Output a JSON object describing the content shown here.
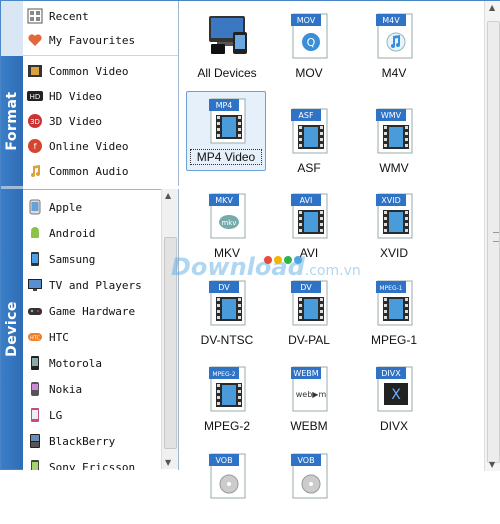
{
  "tabs": {
    "format": "Format",
    "device": "Device"
  },
  "format_list": [
    {
      "label": "Recent",
      "icon": "recent-icon"
    },
    {
      "label": "My Favourites",
      "icon": "heart-icon"
    },
    {
      "label": "Common Video",
      "icon": "film-icon"
    },
    {
      "label": "HD Video",
      "icon": "hd-icon"
    },
    {
      "label": "3D Video",
      "icon": "3d-icon"
    },
    {
      "label": "Online Video",
      "icon": "online-video-icon"
    },
    {
      "label": "Common Audio",
      "icon": "music-note-icon"
    }
  ],
  "device_list": [
    {
      "label": "Apple",
      "icon": "apple-icon"
    },
    {
      "label": "Android",
      "icon": "android-icon"
    },
    {
      "label": "Samsung",
      "icon": "samsung-phone-icon"
    },
    {
      "label": "TV and Players",
      "icon": "tv-icon"
    },
    {
      "label": "Game Hardware",
      "icon": "game-controller-icon"
    },
    {
      "label": "HTC",
      "icon": "htc-icon"
    },
    {
      "label": "Motorola",
      "icon": "motorola-icon"
    },
    {
      "label": "Nokia",
      "icon": "nokia-icon"
    },
    {
      "label": "LG",
      "icon": "lg-phone-icon"
    },
    {
      "label": "BlackBerry",
      "icon": "blackberry-icon"
    },
    {
      "label": "Sony Ericsson",
      "icon": "sony-ericsson-icon"
    }
  ],
  "formats": [
    {
      "label": "All Devices",
      "badge": "",
      "kind": "devices"
    },
    {
      "label": "MOV",
      "badge": "MOV",
      "kind": "quicktime"
    },
    {
      "label": "M4V",
      "badge": "M4V",
      "kind": "itunes"
    },
    {
      "label": "MP4 Video",
      "badge": "MP4",
      "kind": "film",
      "selected": true
    },
    {
      "label": "ASF",
      "badge": "ASF",
      "kind": "film"
    },
    {
      "label": "WMV",
      "badge": "WMV",
      "kind": "film"
    },
    {
      "label": "MKV",
      "badge": "MKV",
      "kind": "mkv"
    },
    {
      "label": "AVI",
      "badge": "AVI",
      "kind": "film"
    },
    {
      "label": "XVID",
      "badge": "XVID",
      "kind": "film"
    },
    {
      "label": "DV-NTSC",
      "badge": "DV",
      "kind": "film"
    },
    {
      "label": "DV-PAL",
      "badge": "DV",
      "kind": "film"
    },
    {
      "label": "MPEG-1",
      "badge": "MPEG-1",
      "kind": "film"
    },
    {
      "label": "MPEG-2",
      "badge": "MPEG-2",
      "kind": "film"
    },
    {
      "label": "WEBM",
      "badge": "WEBM",
      "kind": "webm"
    },
    {
      "label": "DIVX",
      "badge": "DIVX",
      "kind": "divx"
    },
    {
      "label": "",
      "badge": "VOB",
      "kind": "dvd"
    },
    {
      "label": "",
      "badge": "VOB",
      "kind": "dvd"
    }
  ],
  "watermark": {
    "brand": "Download",
    "domain": ".com.vn"
  },
  "colors": {
    "accent": "#2f6db5",
    "badge": "#2e73c6",
    "watermark": "#4fa7e0"
  }
}
